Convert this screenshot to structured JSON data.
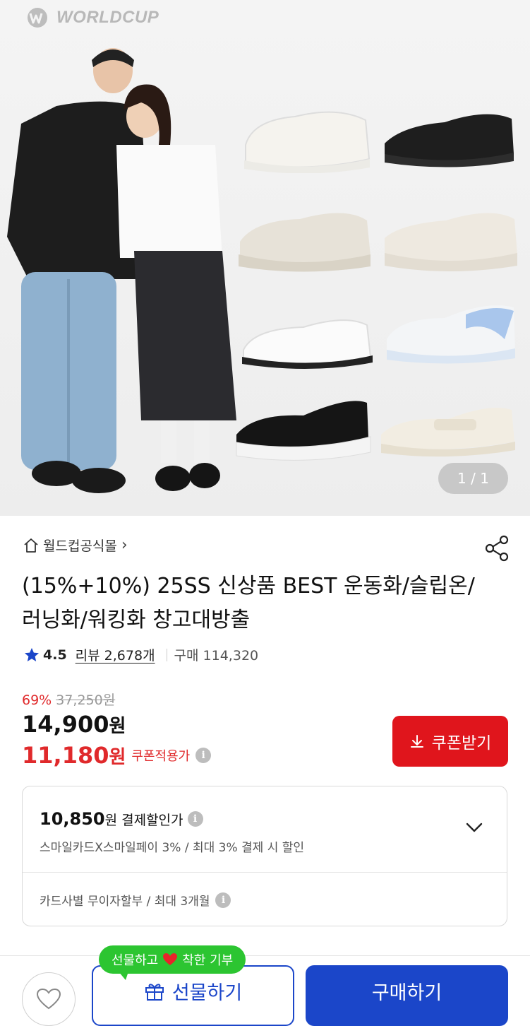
{
  "hero": {
    "logo_text": "WORLDCUP",
    "counter": "1 / 1"
  },
  "store": {
    "name": "월드컵공식몰",
    "chevron": "›"
  },
  "product": {
    "title": "(15%+10%) 25SS 신상품 BEST 운동화/슬립온/러닝화/워킹화 창고대방출",
    "rating": "4.5",
    "review_label": "리뷰 2,678개",
    "purchase_label": "구매 114,320"
  },
  "pricing": {
    "discount_rate": "69%",
    "original_price": "37,250원",
    "price_number": "14,900",
    "price_unit": "원",
    "coupon_price_number": "11,180",
    "coupon_price_unit": "원",
    "coupon_price_label": "쿠폰적용가",
    "coupon_button": "쿠폰받기"
  },
  "benefits": {
    "payment_price_number": "10,850",
    "payment_price_unit": "원",
    "payment_label": "결제할인가",
    "payment_desc": "스마일카드X스마일페이 3% / 최대 3% 결제 시 할인",
    "installment": "카드사별 무이자할부 / 최대 3개월"
  },
  "bottom": {
    "gift_bubble_pre": "선물하고",
    "gift_bubble_post": "착한 기부",
    "gift_button": "선물하기",
    "buy_button": "구매하기"
  },
  "colors": {
    "accent_red": "#e0151c",
    "brand_blue": "#1b46c9",
    "green": "#2cc531"
  },
  "icons": [
    "home-icon",
    "share-icon",
    "star-icon",
    "info-icon",
    "download-icon",
    "chevron-down-icon",
    "heart-icon",
    "gift-icon"
  ]
}
